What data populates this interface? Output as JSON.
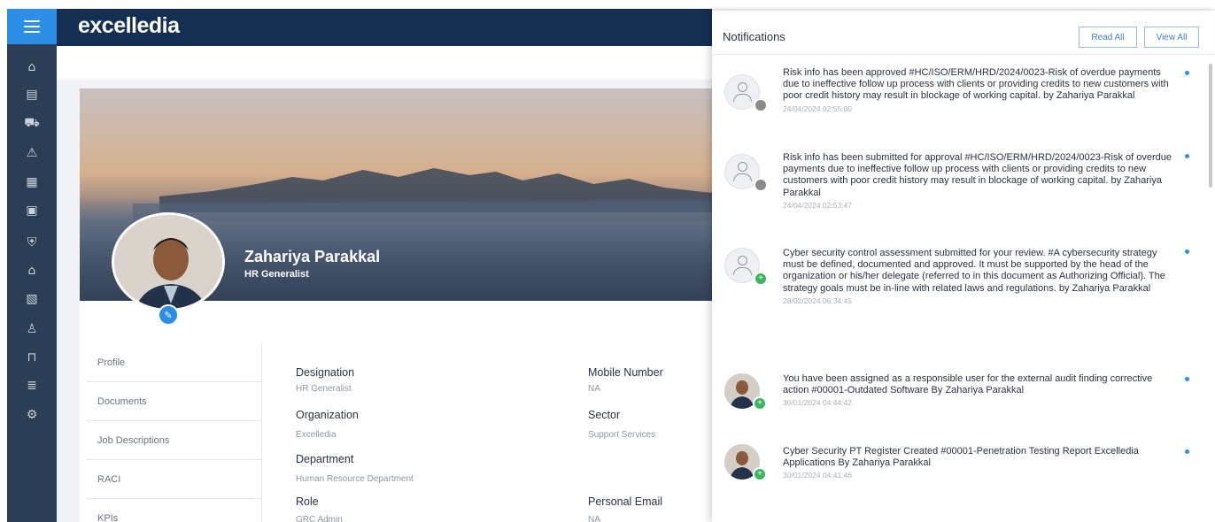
{
  "app": {
    "logo": "excelledia",
    "menu_icon": "hamburger-icon"
  },
  "sidebar": {
    "items": [
      {
        "icon": "home-icon",
        "glyph": "⌂"
      },
      {
        "icon": "building-icon",
        "glyph": "▤"
      },
      {
        "icon": "car-icon",
        "glyph": "⛟"
      },
      {
        "icon": "warning-icon",
        "glyph": "⚠"
      },
      {
        "icon": "document-icon",
        "glyph": "▦"
      },
      {
        "icon": "clipboard-icon",
        "glyph": "▣"
      },
      {
        "icon": "shield-icon",
        "glyph": "⛨"
      },
      {
        "icon": "home-outline-icon",
        "glyph": "⌂"
      },
      {
        "icon": "file-icon",
        "glyph": "▧"
      },
      {
        "icon": "user-icon",
        "glyph": "♙"
      },
      {
        "icon": "lock-icon",
        "glyph": "⊓"
      },
      {
        "icon": "list-icon",
        "glyph": "≣"
      },
      {
        "icon": "settings-icon",
        "glyph": "⚙"
      }
    ]
  },
  "profile": {
    "name": "Zahariya Parakkal",
    "role": "HR Generalist",
    "tabs": [
      "Profile",
      "Documents",
      "Job Descriptions",
      "RACI",
      "KPIs"
    ],
    "details": {
      "designation_label": "Designation",
      "designation_value": "HR Generalist",
      "mobile_label": "Mobile Number",
      "mobile_value": "NA",
      "organization_label": "Organization",
      "organization_value": "Excelledia",
      "sector_label": "Sector",
      "sector_value": "Support Services",
      "department_label": "Department",
      "department_value": "Human Resource Department",
      "role_label": "Role",
      "role_value": "GRC Admin",
      "personal_email_label": "Personal Email",
      "personal_email_value": "NA"
    }
  },
  "notifications": {
    "title": "Notifications",
    "read_all": "Read All",
    "view_all": "View All",
    "items": [
      {
        "text": "Risk info has been approved #HC/ISO/ERM/HRD/2024/0023-Risk of overdue payments due to ineffective follow up process with clients or providing credits to new customers with poor credit history may result in blockage of working capital. by Zahariya Parakkal",
        "time": "24/04/2024 02:55:00",
        "avatar": "generic",
        "badge": "grey"
      },
      {
        "text": "Risk info has been submitted for approval #HC/ISO/ERM/HRD/2024/0023-Risk of overdue payments due to ineffective follow up process with clients or providing credits to new customers with poor credit history may result in blockage of working capital. by Zahariya Parakkal",
        "time": "24/04/2024 02:53:47",
        "avatar": "generic",
        "badge": "grey"
      },
      {
        "text": "Cyber security control assessment submitted for your review. #A cybersecurity strategy must be defined, documented and approved. It must be supported by the head of the organization or his/her delegate (referred to in this document as Authorizing Official). The strategy goals must be in-line with related laws and regulations. by Zahariya Parakkal",
        "time": "28/02/2024 06:34:45",
        "avatar": "generic",
        "badge": "green"
      },
      {
        "text": "You have been assigned as a responsible user for the external audit finding corrective action #00001-Outdated Software By Zahariya Parakkal",
        "time": "30/01/2024 04:44:42",
        "avatar": "photo",
        "badge": "green"
      },
      {
        "text": "Cyber Security PT Register Created #00001-Penetration Testing Report Excelledia Applications By Zahariya Parakkal",
        "time": "30/01/2024 04:41:46",
        "avatar": "photo",
        "badge": "green"
      }
    ]
  },
  "colors": {
    "rail": "#2c3e55",
    "header": "#152f52",
    "accent": "#2d8ee6",
    "badge_green": "#3cb55a"
  }
}
